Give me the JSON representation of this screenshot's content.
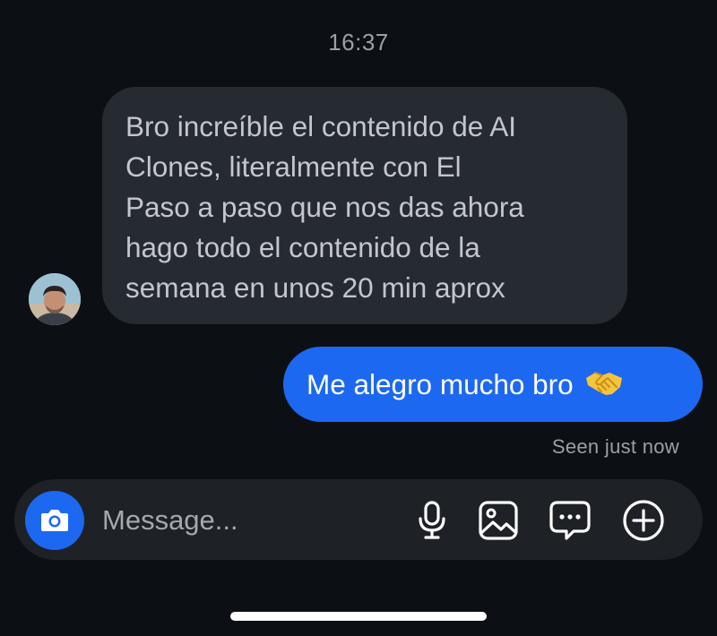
{
  "thread": {
    "timestamp": "16:37",
    "incoming_message": {
      "text": "Bro increíble el contenido de AI\nClones, literalmente con El\nPaso a paso que nos das ahora\nhago todo el contenido de la\nsemana en unos 20 min aprox",
      "avatar_icon": "user-avatar"
    },
    "outgoing_message": {
      "text": "Me alegro mucho bro",
      "emoji_icon": "handshake-emoji"
    },
    "seen_status": "Seen just now"
  },
  "composer": {
    "placeholder": "Message...",
    "camera_icon": "camera-icon",
    "tools": [
      "microphone-icon",
      "image-icon",
      "chat-bubble-icon",
      "plus-circle-icon"
    ]
  },
  "colors": {
    "background": "#0c1015",
    "incoming_bubble": "#262a31",
    "outgoing_bubble": "#1d68f1",
    "composer": "#1e2227",
    "muted_text": "#9aa0a8"
  }
}
